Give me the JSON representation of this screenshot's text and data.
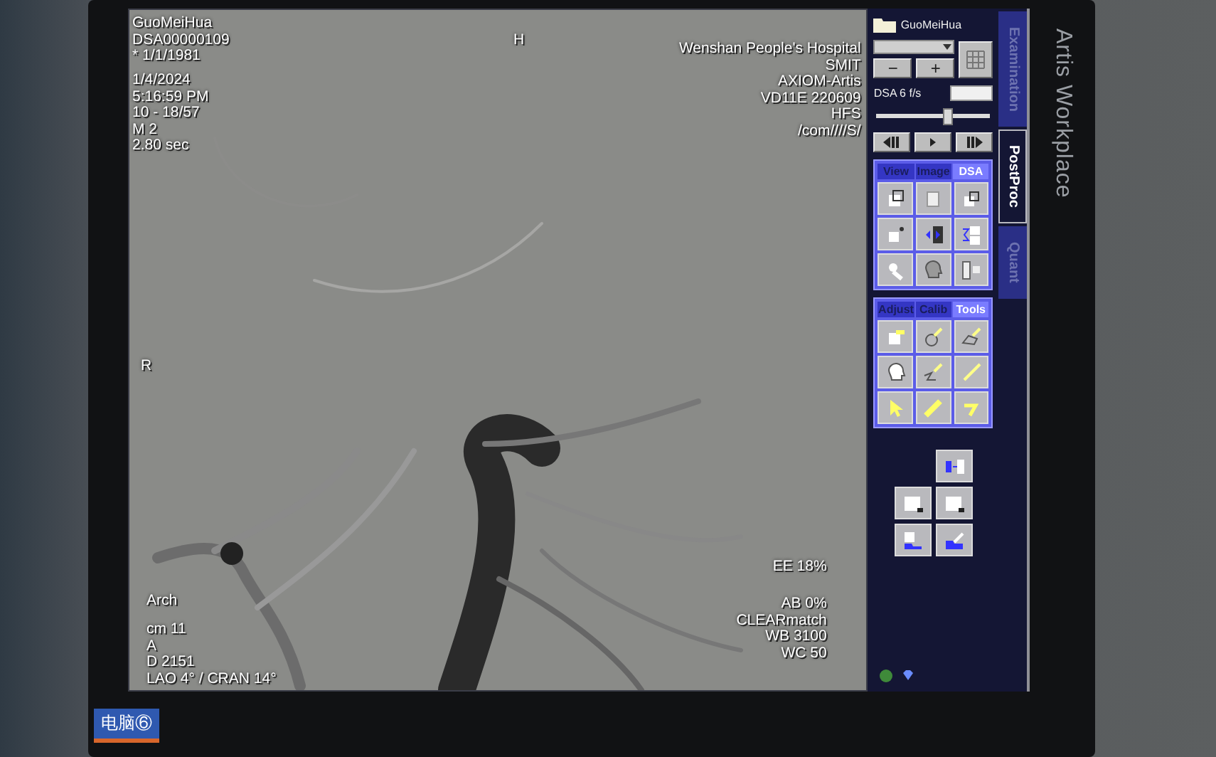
{
  "viewer": {
    "patient_block": [
      "GuoMeiHua",
      "DSA00000109",
      "* 1/1/1981"
    ],
    "study_block": [
      "1/4/2024",
      "5:16:59 PM",
      "10 - 18/57",
      "M 2",
      "2.80 sec"
    ],
    "top_marker": "H",
    "side_marker": "R",
    "site_block": [
      "Wenshan People's Hospital",
      "SMIT",
      "AXIOM-Artis",
      "VD11E 220609",
      "HFS",
      "/com////S/"
    ],
    "program_block": [
      "Arch"
    ],
    "geometry_block": [
      "cm 11",
      "A",
      "D 2151",
      "LAO 4° / CRAN 14°"
    ],
    "edge_label": "EE 18%",
    "processing_block": [
      "AB 0%",
      "CLEARmatch",
      "WB 3100",
      "WC 50"
    ]
  },
  "panel": {
    "patient": "GuoMeiHua",
    "minus": "−",
    "plus": "+",
    "rate_label": "DSA 6 f/s",
    "slider": {
      "level": 0.62
    },
    "groups": [
      {
        "tabs": [
          {
            "label": "View",
            "selected": false
          },
          {
            "label": "Image",
            "selected": false
          },
          {
            "label": "DSA",
            "selected": true
          }
        ]
      },
      {
        "tabs": [
          {
            "label": "Adjust",
            "selected": false
          },
          {
            "label": "Calib",
            "selected": false
          },
          {
            "label": "Tools",
            "selected": true
          }
        ]
      }
    ],
    "side_tabs": [
      {
        "label": "Examination",
        "selected": false
      },
      {
        "label": "PostProc",
        "selected": true
      },
      {
        "label": "Quant",
        "selected": false
      }
    ]
  },
  "bezel_label": "Artis Workplace",
  "sticker": "电脑⑥"
}
